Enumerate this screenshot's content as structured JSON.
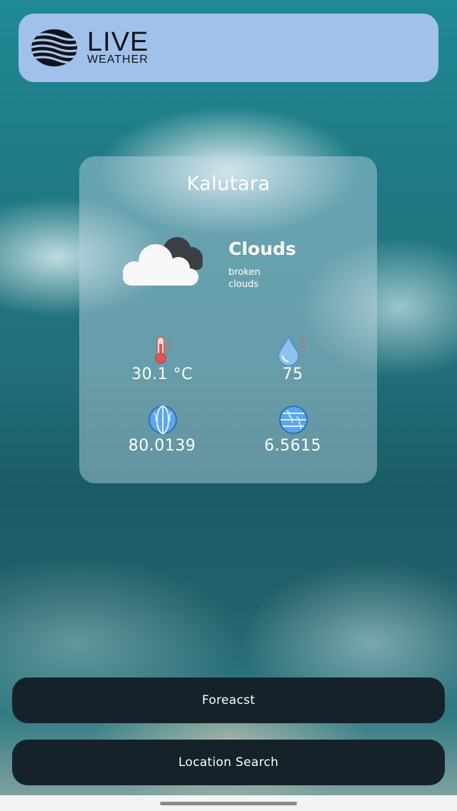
{
  "header": {
    "logo_live": "LIVE",
    "logo_weather": "WEATHER"
  },
  "weather": {
    "city": "Kalutara",
    "condition": "Clouds",
    "description": "broken clouds",
    "condition_icon": "cloud-icon"
  },
  "stats": {
    "temperature": "30.1 °C",
    "temperature_icon": "thermometer-icon",
    "humidity": "75",
    "humidity_icon": "humidity-drop-icon",
    "longitude": "80.0139",
    "longitude_icon": "globe-icon",
    "latitude": "6.5615",
    "latitude_icon": "globe-icon"
  },
  "buttons": {
    "forecast": "Foreacst",
    "location_search": "Location Search"
  },
  "colors": {
    "header_bg": "#a7c4ee",
    "button_bg": "#162229",
    "text": "#ffffff"
  }
}
